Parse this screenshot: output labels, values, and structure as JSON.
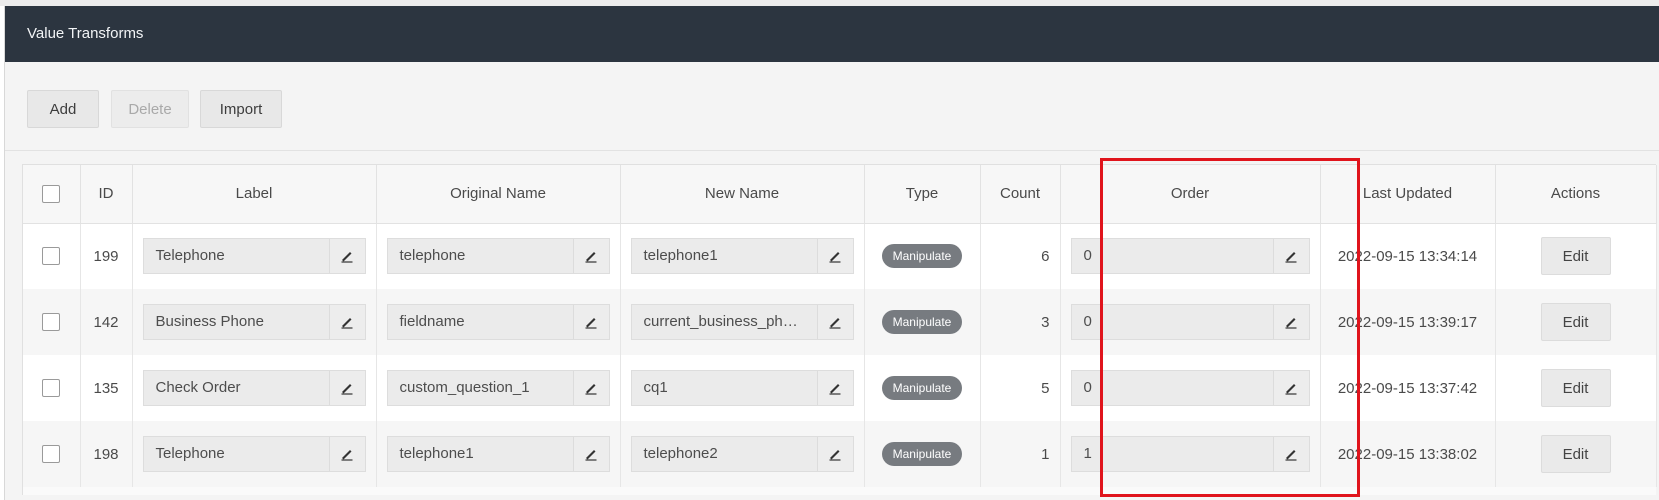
{
  "header": {
    "title": "Value Transforms"
  },
  "toolbar": {
    "add_label": "Add",
    "delete_label": "Delete",
    "import_label": "Import"
  },
  "table": {
    "columns": {
      "id": "ID",
      "label": "Label",
      "original_name": "Original Name",
      "new_name": "New Name",
      "type": "Type",
      "count": "Count",
      "order": "Order",
      "last_updated": "Last Updated",
      "actions": "Actions"
    },
    "rows": [
      {
        "id": "199",
        "label": "Telephone",
        "original_name": "telephone",
        "new_name": "telephone1",
        "type": "Manipulate",
        "count": "6",
        "order": "0",
        "last_updated": "2022-09-15 13:34:14",
        "action": "Edit"
      },
      {
        "id": "142",
        "label": "Business Phone",
        "original_name": "fieldname",
        "new_name": "current_business_phone_...",
        "type": "Manipulate",
        "count": "3",
        "order": "0",
        "last_updated": "2022-09-15 13:39:17",
        "action": "Edit"
      },
      {
        "id": "135",
        "label": "Check Order",
        "original_name": "custom_question_1",
        "new_name": "cq1",
        "type": "Manipulate",
        "count": "5",
        "order": "0",
        "last_updated": "2022-09-15 13:37:42",
        "action": "Edit"
      },
      {
        "id": "198",
        "label": "Telephone",
        "original_name": "telephone1",
        "new_name": "telephone2",
        "type": "Manipulate",
        "count": "1",
        "order": "1",
        "last_updated": "2022-09-15 13:38:02",
        "action": "Edit"
      }
    ]
  },
  "colors": {
    "header_bg": "#2c3540",
    "badge_bg": "#777b80",
    "highlight": "#e0141c"
  },
  "icons": {
    "edit_field": "pencil-icon"
  }
}
